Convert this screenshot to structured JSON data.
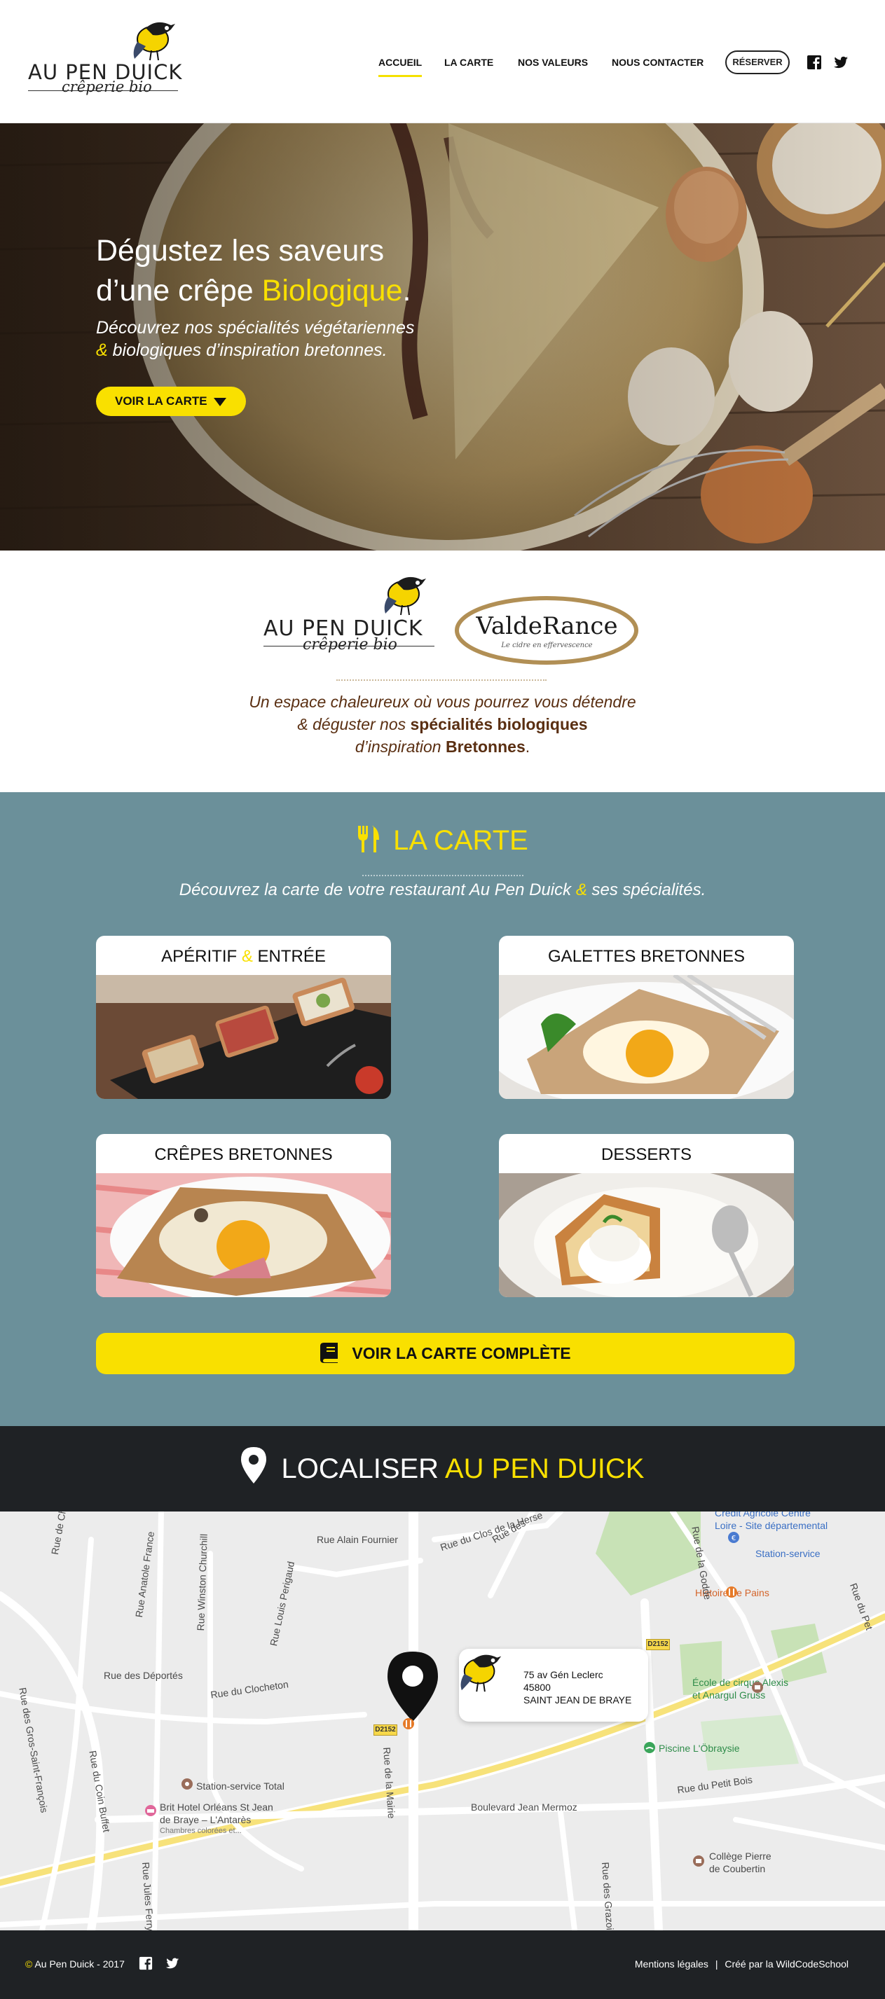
{
  "header": {
    "logo_name": "AU PEN DUICK",
    "logo_sub": "crêperie bio",
    "nav": [
      {
        "label": "ACCUEIL",
        "active": true
      },
      {
        "label": "LA CARTE",
        "active": false
      },
      {
        "label": "NOS VALEURS",
        "active": false
      },
      {
        "label": "NOUS CONTACTER",
        "active": false
      }
    ],
    "reserve_label": "RÉSERVER",
    "social_icons": [
      "facebook-icon",
      "twitter-icon"
    ]
  },
  "hero": {
    "title_line1": "Dégustez les saveurs",
    "title_line2_pre": "d’une crêpe ",
    "title_line2_hl": "Biologique",
    "title_line2_post": ".",
    "sub_line1": "Découvrez nos spécialités végétariennes",
    "sub_amp": "&",
    "sub_line2": " biologiques d’inspiration bretonnes.",
    "cta_label": "VOIR LA CARTE"
  },
  "intro": {
    "partner_logo_text": "ValdeRance",
    "partner_logo_sub": "Le cidre en effervescence",
    "line1": "Un espace chaleureux où vous pourrez vous détendre",
    "line2_pre": "& déguster nos ",
    "line2_bold": "spécialités biologiques",
    "line3_pre": "d’inspiration ",
    "line3_bold": "Bretonnes",
    "line3_post": "."
  },
  "menu": {
    "title": "LA CARTE",
    "sub_pre": "Découvrez la carte de votre restaurant Au Pen Duick ",
    "sub_amp": "&",
    "sub_post": " ses spécialités.",
    "cards": [
      {
        "title_pre": "APÉRITIF ",
        "title_amp": "&",
        "title_post": " ENTRÉE"
      },
      {
        "title": "GALETTES BRETONNES"
      },
      {
        "title": "CRÊPES BRETONNES"
      },
      {
        "title": "DESSERTS"
      }
    ],
    "full_button": "VOIR LA CARTE COMPLÈTE"
  },
  "locate": {
    "title_pre": "LOCALISER ",
    "title_hl": "AU PEN DUICK"
  },
  "map": {
    "address_line1": "75 av Gén Leclerc",
    "address_line2": "45800",
    "address_line3": "SAINT JEAN DE BRAYE",
    "labels": [
      "Rue Alain Fournier",
      "Rue du Clos de la Herse",
      "Rue des Déportés",
      "Rue du Clocheton",
      "Station-service Total",
      "Brit Hotel Orléans St Jean",
      "de Braye – L'Antarès",
      "Chambres colorées et...",
      "Boulevard Jean Mermoz",
      "Crédit Agricole Centre",
      "Loire - Site départemental",
      "Station-service",
      "Histoire de Pains",
      "École de cirque Alexis",
      "et Anargul Gruss",
      "Piscine L'Öbraysie",
      "Rue du Petit Bois",
      "Collège Pierre",
      "de Coubertin",
      "Rue de Charbonnière",
      "Rue Anatole France",
      "Rue Winston Churchill",
      "Rue Louis Perigaud",
      "Rue du Coin Buffet",
      "Rue des Gros-Saint-François",
      "Rue de la Mairie",
      "Rue des Grazoirs",
      "Rue Jules Ferry",
      "Rue de la Godde",
      "Rue des",
      "D2152",
      "Rue du Pet"
    ]
  },
  "footer": {
    "copyright_symbol": "©",
    "copyright": " Au Pen Duick - 2017",
    "legal": "Mentions légales",
    "separator": "|",
    "credit": "Créé par la WildCodeSchool"
  },
  "colors": {
    "accent_yellow": "#f9e000",
    "menu_bg": "#6b909a",
    "dark_bg": "#1f2225",
    "intro_text": "#5a2f12"
  }
}
